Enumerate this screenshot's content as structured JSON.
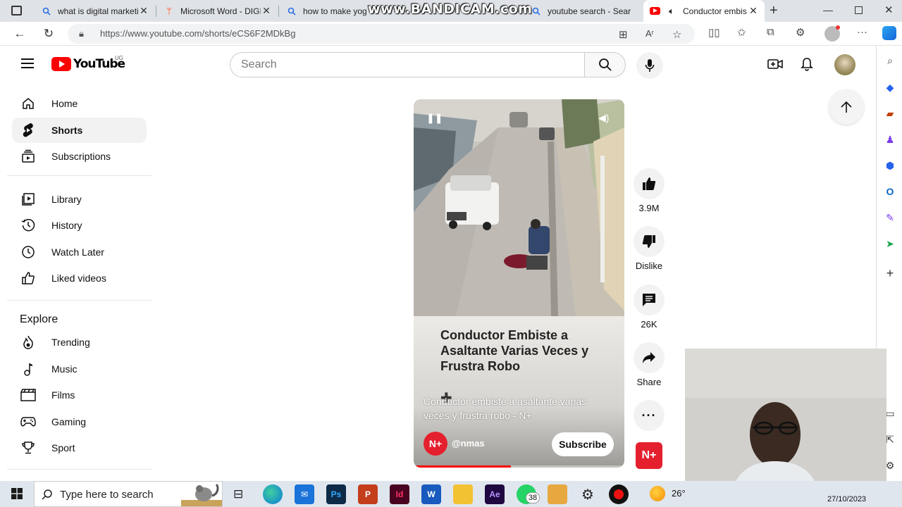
{
  "browser": {
    "tabs": [
      {
        "title": "what is digital marketi",
        "icon": "search-icon",
        "active": false
      },
      {
        "title": "Microsoft Word - DIGI",
        "icon": "hubspot-icon",
        "active": false
      },
      {
        "title": "how to make yogu",
        "icon": "search-icon",
        "active": false
      },
      {
        "title": "youtube search - Sear",
        "icon": "search-icon",
        "active": false
      },
      {
        "title": "Conductor embis",
        "icon": "youtube-icon",
        "active": true
      }
    ],
    "watermark": "www.BANDICAM.com",
    "url_prefix": "https://www.youtube.com",
    "url_path": "/shorts/eCS6F2MDkBg"
  },
  "youtube": {
    "logo_text": "YouTube",
    "country": "UG",
    "search_placeholder": "Search",
    "nav_main": [
      {
        "label": "Home",
        "icon": "home-icon",
        "selected": false
      },
      {
        "label": "Shorts",
        "icon": "shorts-icon",
        "selected": true
      },
      {
        "label": "Subscriptions",
        "icon": "subscriptions-icon",
        "selected": false
      }
    ],
    "nav_library": [
      {
        "label": "Library",
        "icon": "library-icon"
      },
      {
        "label": "History",
        "icon": "history-icon"
      },
      {
        "label": "Watch Later",
        "icon": "watch-later-icon"
      },
      {
        "label": "Liked videos",
        "icon": "liked-icon"
      }
    ],
    "explore_title": "Explore",
    "nav_explore": [
      {
        "label": "Trending",
        "icon": "trending-icon"
      },
      {
        "label": "Music",
        "icon": "music-icon"
      },
      {
        "label": "Films",
        "icon": "films-icon"
      },
      {
        "label": "Gaming",
        "icon": "gaming-icon"
      },
      {
        "label": "Sport",
        "icon": "sport-icon"
      }
    ]
  },
  "short": {
    "overlay_title": "Conductor Embiste a Asaltante Varias Veces y Frustra Robo",
    "description": "Conductor embiste a asaltante varias veces y frustra robo - N+",
    "channel": "@nmas",
    "channel_badge": "N+",
    "subscribe_label": "Subscribe",
    "progress": 0.46,
    "actions": {
      "likes": "3.9M",
      "dislike": "Dislike",
      "comments": "26K",
      "share": "Share"
    }
  },
  "taskbar": {
    "search_placeholder": "Type here to search",
    "whatsapp_badge": "38",
    "temperature": "26°",
    "date": "27/10/2023"
  },
  "colors": {
    "youtube_red": "#ff0000",
    "nmas_red": "#e5202e"
  }
}
